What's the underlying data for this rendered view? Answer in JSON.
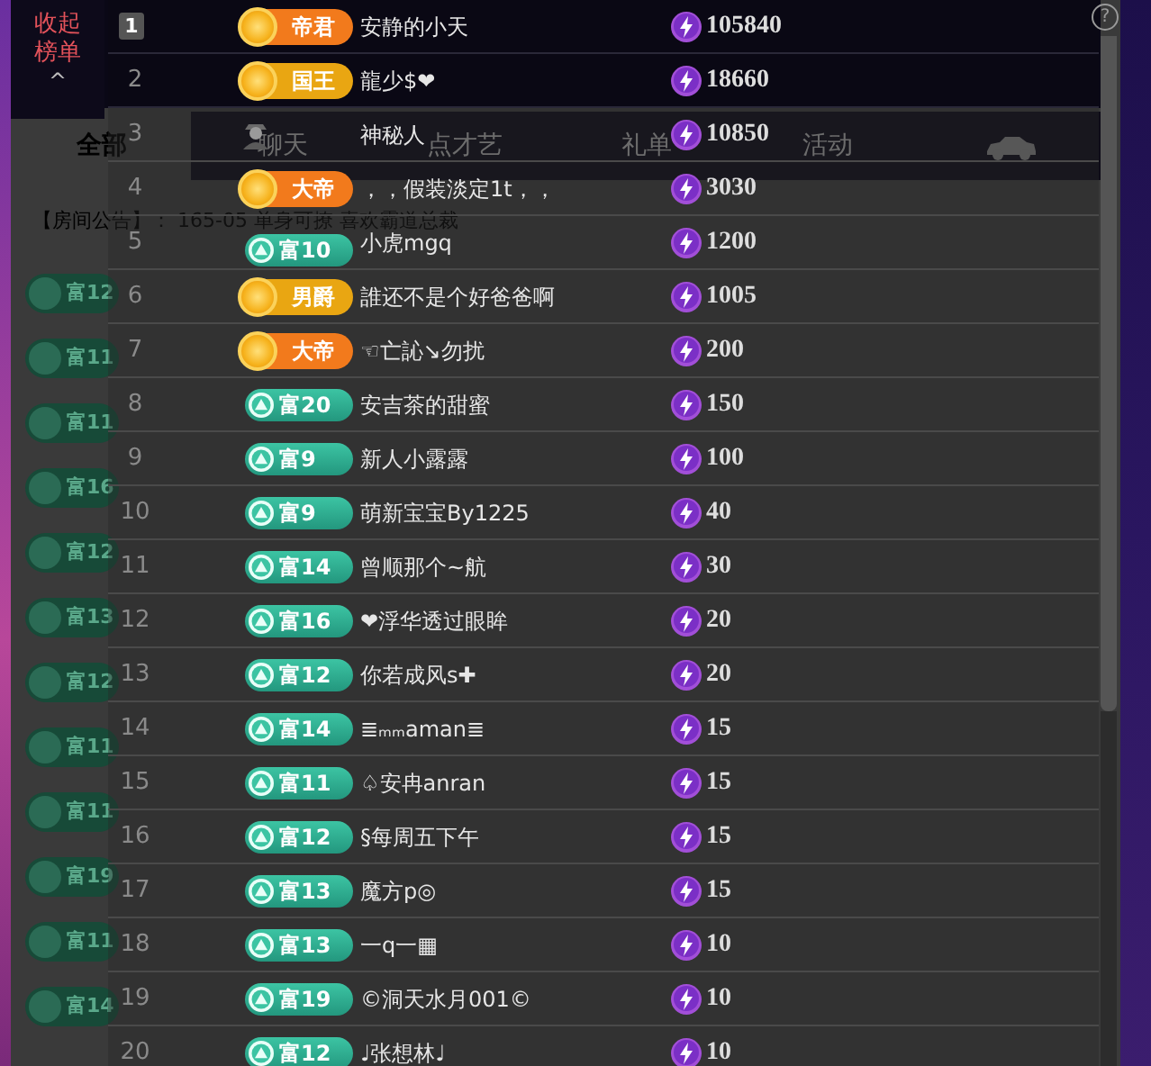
{
  "collapse_button": {
    "label": "收起榜单",
    "chevron": "^"
  },
  "help": "?",
  "stream_tabs": [
    {
      "label": "全部",
      "selected": true
    },
    {
      "label": "聊天",
      "selected": false
    },
    {
      "label": "点才艺",
      "selected": false
    },
    {
      "label": "礼单",
      "selected": false
    },
    {
      "label": "活动",
      "selected": false
    }
  ],
  "announcement": "【房间公告】： 165-05 单身可撩 喜欢霸道总裁",
  "chat_badges": [
    "富12",
    "富11",
    "富11",
    "富16",
    "富12",
    "富13",
    "富12",
    "富11",
    "富11",
    "富19",
    "富11",
    "富14"
  ],
  "ranking": [
    {
      "rank": "1",
      "highlighted": true,
      "badge": {
        "kind": "royal",
        "label": "帝君",
        "color": "#f27a1c"
      },
      "name": "安静的小天",
      "score": "105840"
    },
    {
      "rank": "2",
      "highlighted": false,
      "badge": {
        "kind": "royal",
        "label": "国王",
        "color": "#e9a612"
      },
      "name": "龍少$❤",
      "score": "18660"
    },
    {
      "rank": "3",
      "highlighted": false,
      "badge": {
        "kind": "mystery"
      },
      "name": "神秘人",
      "score": "10850"
    },
    {
      "rank": "4",
      "highlighted": false,
      "badge": {
        "kind": "royal",
        "label": "大帝",
        "color": "#f27a1c"
      },
      "name": "，，假装淡定1t，，",
      "score": "3030"
    },
    {
      "rank": "5",
      "highlighted": false,
      "badge": {
        "kind": "wealth",
        "label": "富10"
      },
      "name": "小虎mgq",
      "score": "1200"
    },
    {
      "rank": "6",
      "highlighted": false,
      "badge": {
        "kind": "royal",
        "label": "男爵",
        "color": "#e9a612"
      },
      "name": "誰还不是个好爸爸啊",
      "score": "1005"
    },
    {
      "rank": "7",
      "highlighted": false,
      "badge": {
        "kind": "royal",
        "label": "大帝",
        "color": "#f27a1c"
      },
      "name": "☜亡訫↘勿扰",
      "score": "200"
    },
    {
      "rank": "8",
      "highlighted": false,
      "badge": {
        "kind": "wealth",
        "label": "富20"
      },
      "name": "安吉茶的甜蜜",
      "score": "150"
    },
    {
      "rank": "9",
      "highlighted": false,
      "badge": {
        "kind": "wealth",
        "label": "富9"
      },
      "name": "新人小露露",
      "score": "100"
    },
    {
      "rank": "10",
      "highlighted": false,
      "badge": {
        "kind": "wealth",
        "label": "富9"
      },
      "name": "萌新宝宝By1225",
      "score": "40"
    },
    {
      "rank": "11",
      "highlighted": false,
      "badge": {
        "kind": "wealth",
        "label": "富14"
      },
      "name": "曾顺那个~航",
      "score": "30"
    },
    {
      "rank": "12",
      "highlighted": false,
      "badge": {
        "kind": "wealth",
        "label": "富16"
      },
      "name": "❤浮华透过眼眸",
      "score": "20"
    },
    {
      "rank": "13",
      "highlighted": false,
      "badge": {
        "kind": "wealth",
        "label": "富12"
      },
      "name": "你若成风s✚",
      "score": "20"
    },
    {
      "rank": "14",
      "highlighted": false,
      "badge": {
        "kind": "wealth",
        "label": "富14"
      },
      "name": "≣ₘₘaman≣",
      "score": "15"
    },
    {
      "rank": "15",
      "highlighted": false,
      "badge": {
        "kind": "wealth",
        "label": "富11"
      },
      "name": "♤安冉anran",
      "score": "15"
    },
    {
      "rank": "16",
      "highlighted": false,
      "badge": {
        "kind": "wealth",
        "label": "富12"
      },
      "name": "§每周五下午",
      "score": "15"
    },
    {
      "rank": "17",
      "highlighted": false,
      "badge": {
        "kind": "wealth",
        "label": "富13"
      },
      "name": "魔方p◎",
      "score": "15"
    },
    {
      "rank": "18",
      "highlighted": false,
      "badge": {
        "kind": "wealth",
        "label": "富13"
      },
      "name": "一q一▦",
      "score": "10"
    },
    {
      "rank": "19",
      "highlighted": false,
      "badge": {
        "kind": "wealth",
        "label": "富19"
      },
      "name": "©洞天水月001©",
      "score": "10"
    },
    {
      "rank": "20",
      "highlighted": false,
      "badge": {
        "kind": "wealth",
        "label": "富12"
      },
      "name": "♩张想林♩",
      "score": "10"
    }
  ]
}
